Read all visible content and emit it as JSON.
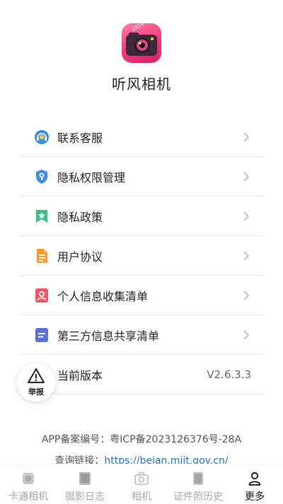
{
  "app": {
    "name": "听风相机"
  },
  "menu": [
    {
      "label": "联系客服",
      "icon": "headset-icon"
    },
    {
      "label": "隐私权限管理",
      "icon": "shield-key-icon"
    },
    {
      "label": "隐私政策",
      "icon": "bookmark-star-icon"
    },
    {
      "label": "用户协议",
      "icon": "document-icon"
    },
    {
      "label": "个人信息收集清单",
      "icon": "person-card-icon"
    },
    {
      "label": "第三方信息共享清单",
      "icon": "list-card-icon"
    },
    {
      "label": "当前版本",
      "value": "V2.6.3.3"
    }
  ],
  "report": {
    "label": "举报",
    "icon": "warning-icon"
  },
  "footer": {
    "icp": "APP备案编号：粤ICP备2023126376号-28A",
    "query_label": "查询链接：",
    "query_link": "https://beian.miit.gov.cn/"
  },
  "tabs": [
    {
      "label": "卡通相机",
      "icon": "cartoon-camera-icon"
    },
    {
      "label": "摄影日志",
      "icon": "book-icon"
    },
    {
      "label": "相机",
      "icon": "camera-icon"
    },
    {
      "label": "证件照历史",
      "icon": "id-photo-icon"
    },
    {
      "label": "更多",
      "icon": "person-icon",
      "active": true
    }
  ],
  "colors": {
    "brand_pink": "#f03a78",
    "link": "#1a73e8"
  }
}
